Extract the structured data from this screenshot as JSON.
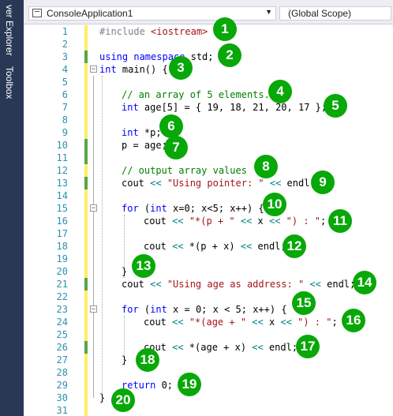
{
  "side_tabs": [
    "ver Explorer",
    "Toolbox"
  ],
  "toolbar": {
    "project": "ConsoleApplication1",
    "scope": "(Global Scope)"
  },
  "lines": [
    {
      "n": "1"
    },
    {
      "n": "2"
    },
    {
      "n": "3"
    },
    {
      "n": "4"
    },
    {
      "n": "5"
    },
    {
      "n": "6"
    },
    {
      "n": "7"
    },
    {
      "n": "8"
    },
    {
      "n": "9"
    },
    {
      "n": "10"
    },
    {
      "n": "11"
    },
    {
      "n": "12"
    },
    {
      "n": "13"
    },
    {
      "n": "14"
    },
    {
      "n": "15"
    },
    {
      "n": "16"
    },
    {
      "n": "17"
    },
    {
      "n": "18"
    },
    {
      "n": "19"
    },
    {
      "n": "20"
    },
    {
      "n": "21"
    },
    {
      "n": "22"
    },
    {
      "n": "23"
    },
    {
      "n": "24"
    },
    {
      "n": "25"
    },
    {
      "n": "26"
    },
    {
      "n": "27"
    },
    {
      "n": "28"
    },
    {
      "n": "29"
    },
    {
      "n": "30"
    },
    {
      "n": "31"
    }
  ],
  "code": {
    "l1_a": "#include ",
    "l1_b": "<iostream>",
    "l3_a": "using",
    "l3_b": " namespace",
    "l3_c": " std;",
    "l4_a": "int",
    "l4_b": " main() {",
    "l6": "// an array of 5 elements.",
    "l7_a": "int",
    "l7_b": " age[5] = { 19, 18, 21, 20, 17 };",
    "l9_a": "int",
    "l9_b": " *p;",
    "l10": "p = age;",
    "l12": "// output array values",
    "l13_a": "cout ",
    "l13_b": "<<",
    "l13_c": " ",
    "l13_d": "\"Using pointer: \"",
    "l13_e": " ",
    "l13_f": "<<",
    "l13_g": " endl;",
    "l15_a": "for",
    "l15_b": " (",
    "l15_c": "int",
    "l15_d": " x=0; x<5; x++) {",
    "l16_a": "cout ",
    "l16_b": "<<",
    "l16_c": " ",
    "l16_d": "\"*(p + \"",
    "l16_e": " ",
    "l16_f": "<<",
    "l16_g": " x ",
    "l16_h": "<<",
    "l16_i": " ",
    "l16_j": "\") : \"",
    "l16_k": ";",
    "l18_a": "cout ",
    "l18_b": "<<",
    "l18_c": " *(p + x) ",
    "l18_d": "<<",
    "l18_e": " endl;",
    "l20": "}",
    "l21_a": "cout ",
    "l21_b": "<<",
    "l21_c": " ",
    "l21_d": "\"Using age as address: \"",
    "l21_e": " ",
    "l21_f": "<<",
    "l21_g": " endl;",
    "l23_a": "for",
    "l23_b": " (",
    "l23_c": "int",
    "l23_d": " x = 0; x < 5; x++) {",
    "l24_a": "cout ",
    "l24_b": "<<",
    "l24_c": " ",
    "l24_d": "\"*(age + \"",
    "l24_e": " ",
    "l24_f": "<<",
    "l24_g": " x ",
    "l24_h": "<<",
    "l24_i": " ",
    "l24_j": "\") : \"",
    "l24_k": ";",
    "l26_a": "cout ",
    "l26_b": "<<",
    "l26_c": " *(age + x) ",
    "l26_d": "<<",
    "l26_e": " endl;",
    "l27": "}",
    "l29_a": "return",
    "l29_b": " 0;",
    "l30": "}"
  },
  "badges": [
    "1",
    "2",
    "3",
    "4",
    "5",
    "6",
    "7",
    "8",
    "9",
    "10",
    "11",
    "12",
    "13",
    "14",
    "15",
    "16",
    "17",
    "18",
    "19",
    "20"
  ],
  "colors": {
    "badge": "#08a808",
    "keyword": "#0000ff",
    "comment": "#008000",
    "string": "#a31515",
    "line_number": "#2b91af"
  }
}
